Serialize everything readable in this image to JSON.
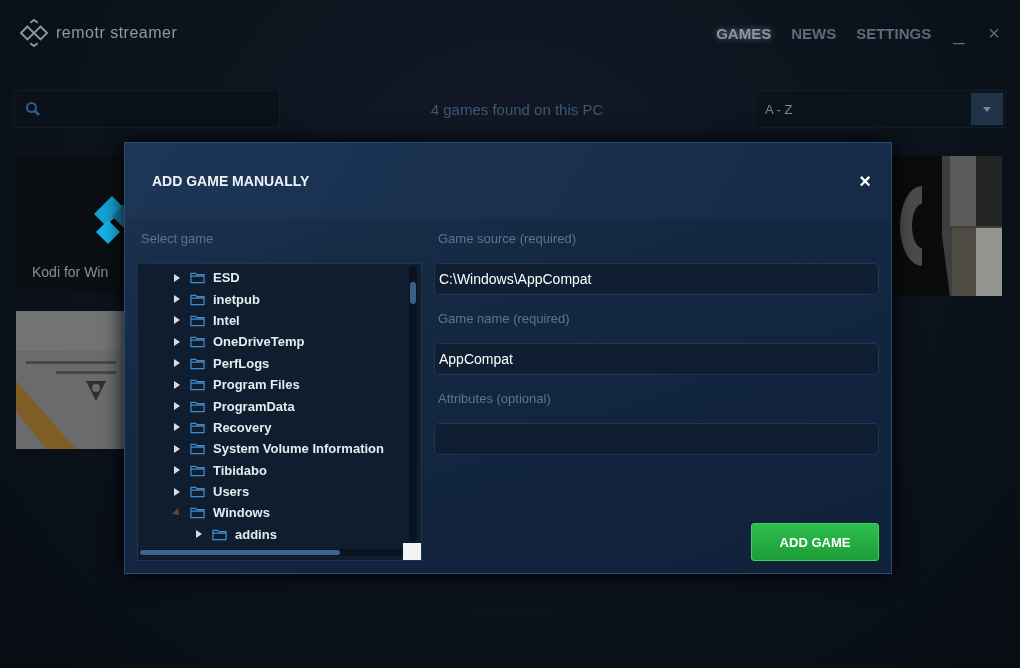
{
  "app": {
    "name": "remotr streamer"
  },
  "nav": [
    {
      "label": "GAMES",
      "selected": true
    },
    {
      "label": "NEWS",
      "selected": false
    },
    {
      "label": "SETTINGS",
      "selected": false
    }
  ],
  "window_controls": [
    "_",
    "×"
  ],
  "toolbar": {
    "count_text": "4 games found on this PC",
    "sort": "A - Z"
  },
  "tiles": [
    {
      "kind": "kodi",
      "title": "Kodi for Win"
    },
    {
      "kind": "space"
    },
    {
      "kind": "covers"
    }
  ],
  "dialog": {
    "title": "ADD GAME MANUALLY",
    "close": "×",
    "tree_label": "Select game",
    "tree": [
      {
        "name": "ESD",
        "expanded": false
      },
      {
        "name": "inetpub",
        "expanded": false
      },
      {
        "name": "Intel",
        "expanded": false
      },
      {
        "name": "OneDriveTemp",
        "expanded": false
      },
      {
        "name": "PerfLogs",
        "expanded": false
      },
      {
        "name": "Program Files",
        "expanded": false
      },
      {
        "name": "ProgramData",
        "expanded": false
      },
      {
        "name": "Recovery",
        "expanded": false
      },
      {
        "name": "System Volume Information",
        "expanded": false
      },
      {
        "name": "Tibidabo",
        "expanded": false
      },
      {
        "name": "Users",
        "expanded": false
      },
      {
        "name": "Windows",
        "expanded": true,
        "children": [
          {
            "name": "addins",
            "expanded": false
          }
        ]
      }
    ],
    "fields": [
      {
        "label": "Game source (required)",
        "value": "C:\\Windows\\AppCompat"
      },
      {
        "label": "Game name (required)",
        "value": "AppCompat"
      },
      {
        "label": "Attributes (optional)"
      }
    ],
    "button": "ADD GAME"
  }
}
